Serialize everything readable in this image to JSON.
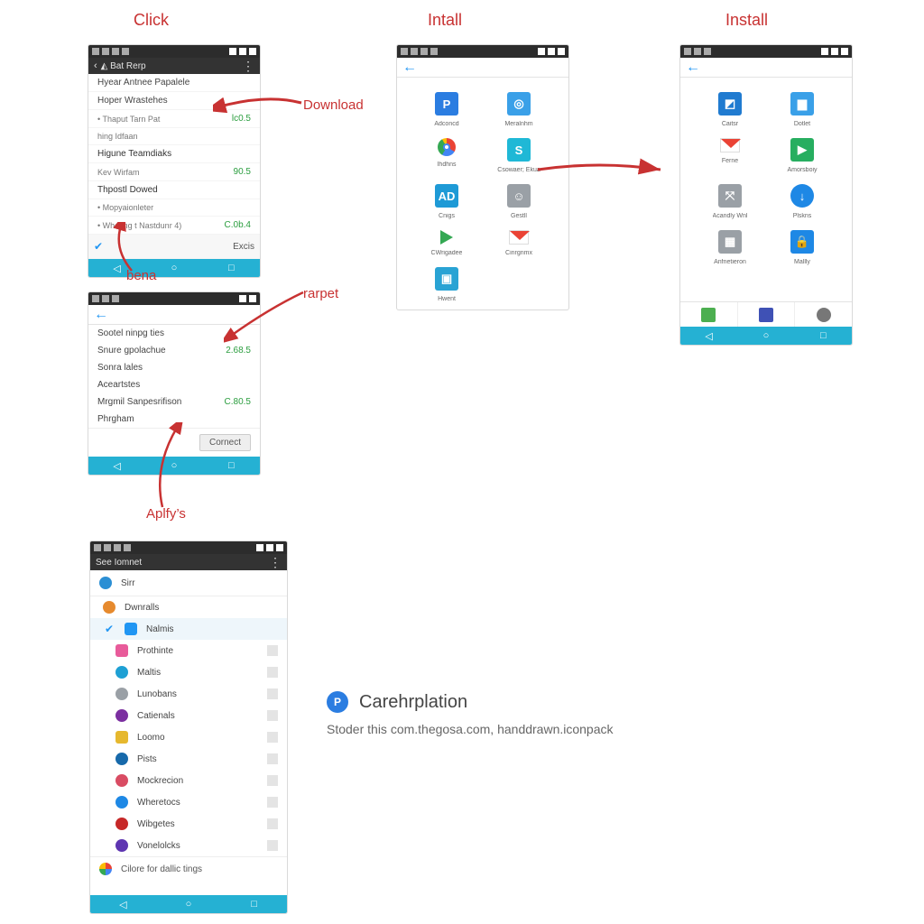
{
  "headings": {
    "click": "Click",
    "install1": "Intall",
    "install2": "Install"
  },
  "annotations": {
    "download": "Download",
    "bena": "bena",
    "rarpet": "rarpet",
    "apply": "Aplfy’s"
  },
  "colors": {
    "accent": "#25b1d3",
    "anno": "#c83232",
    "green": "#2a9d3e",
    "blue": "#2196f3"
  },
  "phone1": {
    "title": "◭ Bat Rerp",
    "rows": [
      {
        "label": "Hyear Antnee Papalele",
        "value": ""
      },
      {
        "label": "Hoper Wrastehes",
        "value": ""
      },
      {
        "label": "• Thaput Tarn Pat",
        "value": "lc0.5",
        "sub": true
      },
      {
        "label": "hing Idfaan",
        "value": "",
        "sub": true
      },
      {
        "label": "Higune Teamdiaks",
        "value": "",
        "head": true
      },
      {
        "label": "Kev Wirfam",
        "value": "90.5",
        "sub": true
      },
      {
        "label": "Thpostl Dowed",
        "value": "",
        "head": true
      },
      {
        "label": "• Mopyaionleter",
        "value": "",
        "sub": true
      },
      {
        "label": "• Wheting t Nastdunr 4)",
        "value": "C.0b.4",
        "sub": true
      }
    ],
    "selrow": "Excis"
  },
  "phone2": {
    "rows": [
      {
        "label": "Sootel ninpg ties",
        "value": ""
      },
      {
        "label": "Snure gpolachue",
        "value": "2.68.5"
      },
      {
        "label": "Sonra lales",
        "value": ""
      },
      {
        "label": "Aceartstes",
        "value": ""
      },
      {
        "label": "Mrgmil Sanpesrifison",
        "value": "C.80.5"
      },
      {
        "label": "Phrgham",
        "value": ""
      }
    ],
    "btn": "Cornect"
  },
  "phone3": {
    "items": [
      {
        "label": "Adconcd",
        "bg": "#2b7de1",
        "txt": "P"
      },
      {
        "label": "Meralnhm",
        "bg": "#3aa0e8",
        "txt": "◎"
      },
      {
        "label": "Ihdhns",
        "bg": "#ffffff",
        "txt": "G",
        "chrome": true
      },
      {
        "label": "Csowaer; Ekua",
        "bg": "#1fb8d6",
        "txt": "S"
      },
      {
        "label": "Cnigs",
        "bg": "#1e9ad6",
        "txt": "AD"
      },
      {
        "label": "Gestll",
        "bg": "#9aa0a6",
        "txt": "☺"
      },
      {
        "label": "CWrigadee",
        "bg": "#ffffff",
        "txt": "▶",
        "play": true
      },
      {
        "label": "Cinrgnmx",
        "bg": "#ffffff",
        "txt": "M",
        "gmail": true
      },
      {
        "label": "Hwent",
        "bg": "#29a3d4",
        "txt": "▣"
      }
    ]
  },
  "phone5": {
    "items": [
      {
        "label": "Caitsr",
        "bg": "#207bd0",
        "txt": "◩"
      },
      {
        "label": "Dotlet",
        "bg": "#3aa0e8",
        "txt": "▆"
      },
      {
        "label": "Ferne",
        "bg": "#ffffff",
        "txt": "M",
        "gmail": true
      },
      {
        "label": "Amorsboiy",
        "bg": "#27ae60",
        "txt": "▶"
      },
      {
        "label": "Acandly Wnl",
        "bg": "#9aa0a6",
        "txt": "⤧"
      },
      {
        "label": "Plskns",
        "bg": "#1e88e5",
        "txt": "↓",
        "round": true
      },
      {
        "label": "Anfnetieron",
        "bg": "#9aa0a6",
        "txt": "▦"
      },
      {
        "label": "Mallly",
        "bg": "#1e88e5",
        "txt": "🔒"
      }
    ],
    "tabs": [
      {
        "bg": "#4caf50"
      },
      {
        "bg": "#3f51b5"
      },
      {
        "bg": "#777"
      }
    ]
  },
  "phone4": {
    "title": "See Iomnet",
    "top": "Sirr",
    "rows": [
      {
        "label": "Dwnralls",
        "bg": "#e68a2e",
        "round": true
      },
      {
        "label": "Nalmis",
        "bg": "#2196f3",
        "check": true,
        "sel": true
      },
      {
        "label": "Prothinte",
        "bg": "#e85b9a"
      },
      {
        "label": "Maltis",
        "bg": "#1ea0d4",
        "round": true
      },
      {
        "label": "Lunobans",
        "bg": "#9aa0a6",
        "round": true
      },
      {
        "label": "Catienals",
        "bg": "#7b2fa0",
        "round": true
      },
      {
        "label": "Loomo",
        "bg": "#e6b82e"
      },
      {
        "label": "Pists",
        "bg": "#1769aa",
        "round": true
      },
      {
        "label": "Mockrecion",
        "bg": "#d94c63",
        "round": true
      },
      {
        "label": "Wheretocs",
        "bg": "#1e88e5",
        "round": true
      },
      {
        "label": "Wibgetes",
        "bg": "#c62828",
        "round": true
      },
      {
        "label": "Vonelolcks",
        "bg": "#5e35b1",
        "round": true
      }
    ],
    "last": "Cilore for dallic tings"
  },
  "caption": {
    "title": "Carehrplation",
    "sub": "Stoder this com.thegosa.com, handdrawn.iconpack",
    "icon": "P"
  }
}
